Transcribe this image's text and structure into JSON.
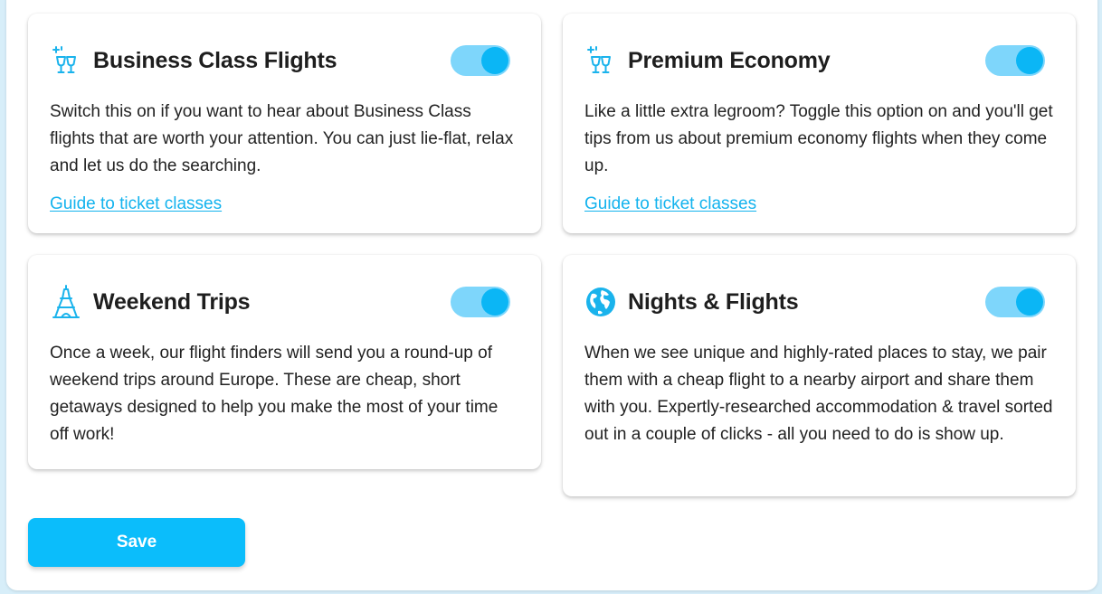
{
  "cards": [
    {
      "title": "Business Class Flights",
      "icon": "champagne-glasses-icon",
      "enabled": true,
      "description": "Switch this on if you want to hear about Business Class flights that are worth your attention. You can just lie-flat, relax and let us do the searching.",
      "link": "Guide to ticket classes"
    },
    {
      "title": "Premium Economy",
      "icon": "champagne-glasses-icon",
      "enabled": true,
      "description": "Like a little extra legroom? Toggle this option on and you'll get tips from us about premium economy flights when they come up.",
      "link": "Guide to ticket classes"
    },
    {
      "title": "Weekend Trips",
      "icon": "eiffel-tower-icon",
      "enabled": true,
      "description": "Once a week, our flight finders will send you a round-up of weekend trips around Europe. These are cheap, short getaways designed to help you make the most of your time off work!"
    },
    {
      "title": "Nights & Flights",
      "icon": "globe-icon",
      "enabled": true,
      "description": "When we see unique and highly-rated places to stay, we pair them with a cheap flight to a nearby airport and share them with you. Expertly-researched accommodation & travel sorted out in a couple of clicks - all you need to do is show up."
    }
  ],
  "save_label": "Save",
  "colors": {
    "accent": "#0bb6f5",
    "toggle_track": "#7ed6fb",
    "link": "#14b3ee",
    "background": "#d7eef9"
  }
}
